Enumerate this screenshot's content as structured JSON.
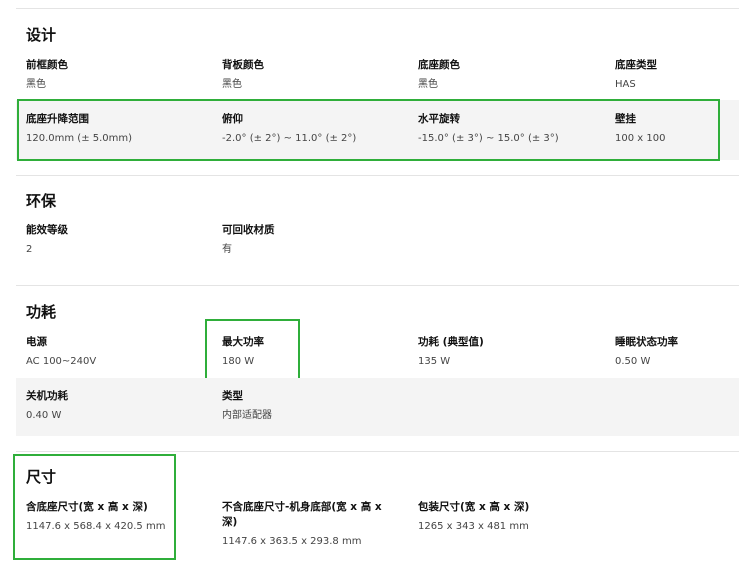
{
  "sections": [
    {
      "title": "设计",
      "specs": [
        {
          "label": "前框颜色",
          "value": "黑色"
        },
        {
          "label": "背板颜色",
          "value": "黑色"
        },
        {
          "label": "底座颜色",
          "value": "黑色"
        },
        {
          "label": "底座类型",
          "value": "HAS"
        },
        {
          "label": "底座升降范围",
          "value": "120.0mm (± 5.0mm)"
        },
        {
          "label": "俯仰",
          "value": "-2.0° (± 2°) ~ 11.0° (± 2°)"
        },
        {
          "label": "水平旋转",
          "value": "-15.0° (± 3°) ~ 15.0° (± 3°)"
        },
        {
          "label": "壁挂",
          "value": "100 x 100"
        }
      ]
    },
    {
      "title": "环保",
      "specs": [
        {
          "label": "能效等级",
          "value": "2"
        },
        {
          "label": "可回收材质",
          "value": "有"
        }
      ]
    },
    {
      "title": "功耗",
      "specs": [
        {
          "label": "电源",
          "value": "AC 100~240V"
        },
        {
          "label": "最大功率",
          "value": "180 W"
        },
        {
          "label": "功耗 (典型值)",
          "value": "135 W"
        },
        {
          "label": "睡眠状态功率",
          "value": "0.50 W"
        },
        {
          "label": "关机功耗",
          "value": "0.40 W"
        },
        {
          "label": "类型",
          "value": "内部适配器"
        }
      ]
    },
    {
      "title": "尺寸",
      "specs": [
        {
          "label": "含底座尺寸(宽 x 高 x 深)",
          "value": "1147.6 x 568.4 x 420.5 mm"
        },
        {
          "label": "不含底座尺寸-机身底部(宽 x 高 x 深)",
          "value": "1147.6 x 363.5 x 293.8 mm"
        },
        {
          "label": "包装尺寸(宽 x 高 x 深)",
          "value": "1265 x 343 x 481 mm"
        }
      ]
    }
  ],
  "colors": {
    "highlight_border": "#2fae3a",
    "band_background": "#f4f4f4",
    "divider": "#e4e4e4"
  }
}
